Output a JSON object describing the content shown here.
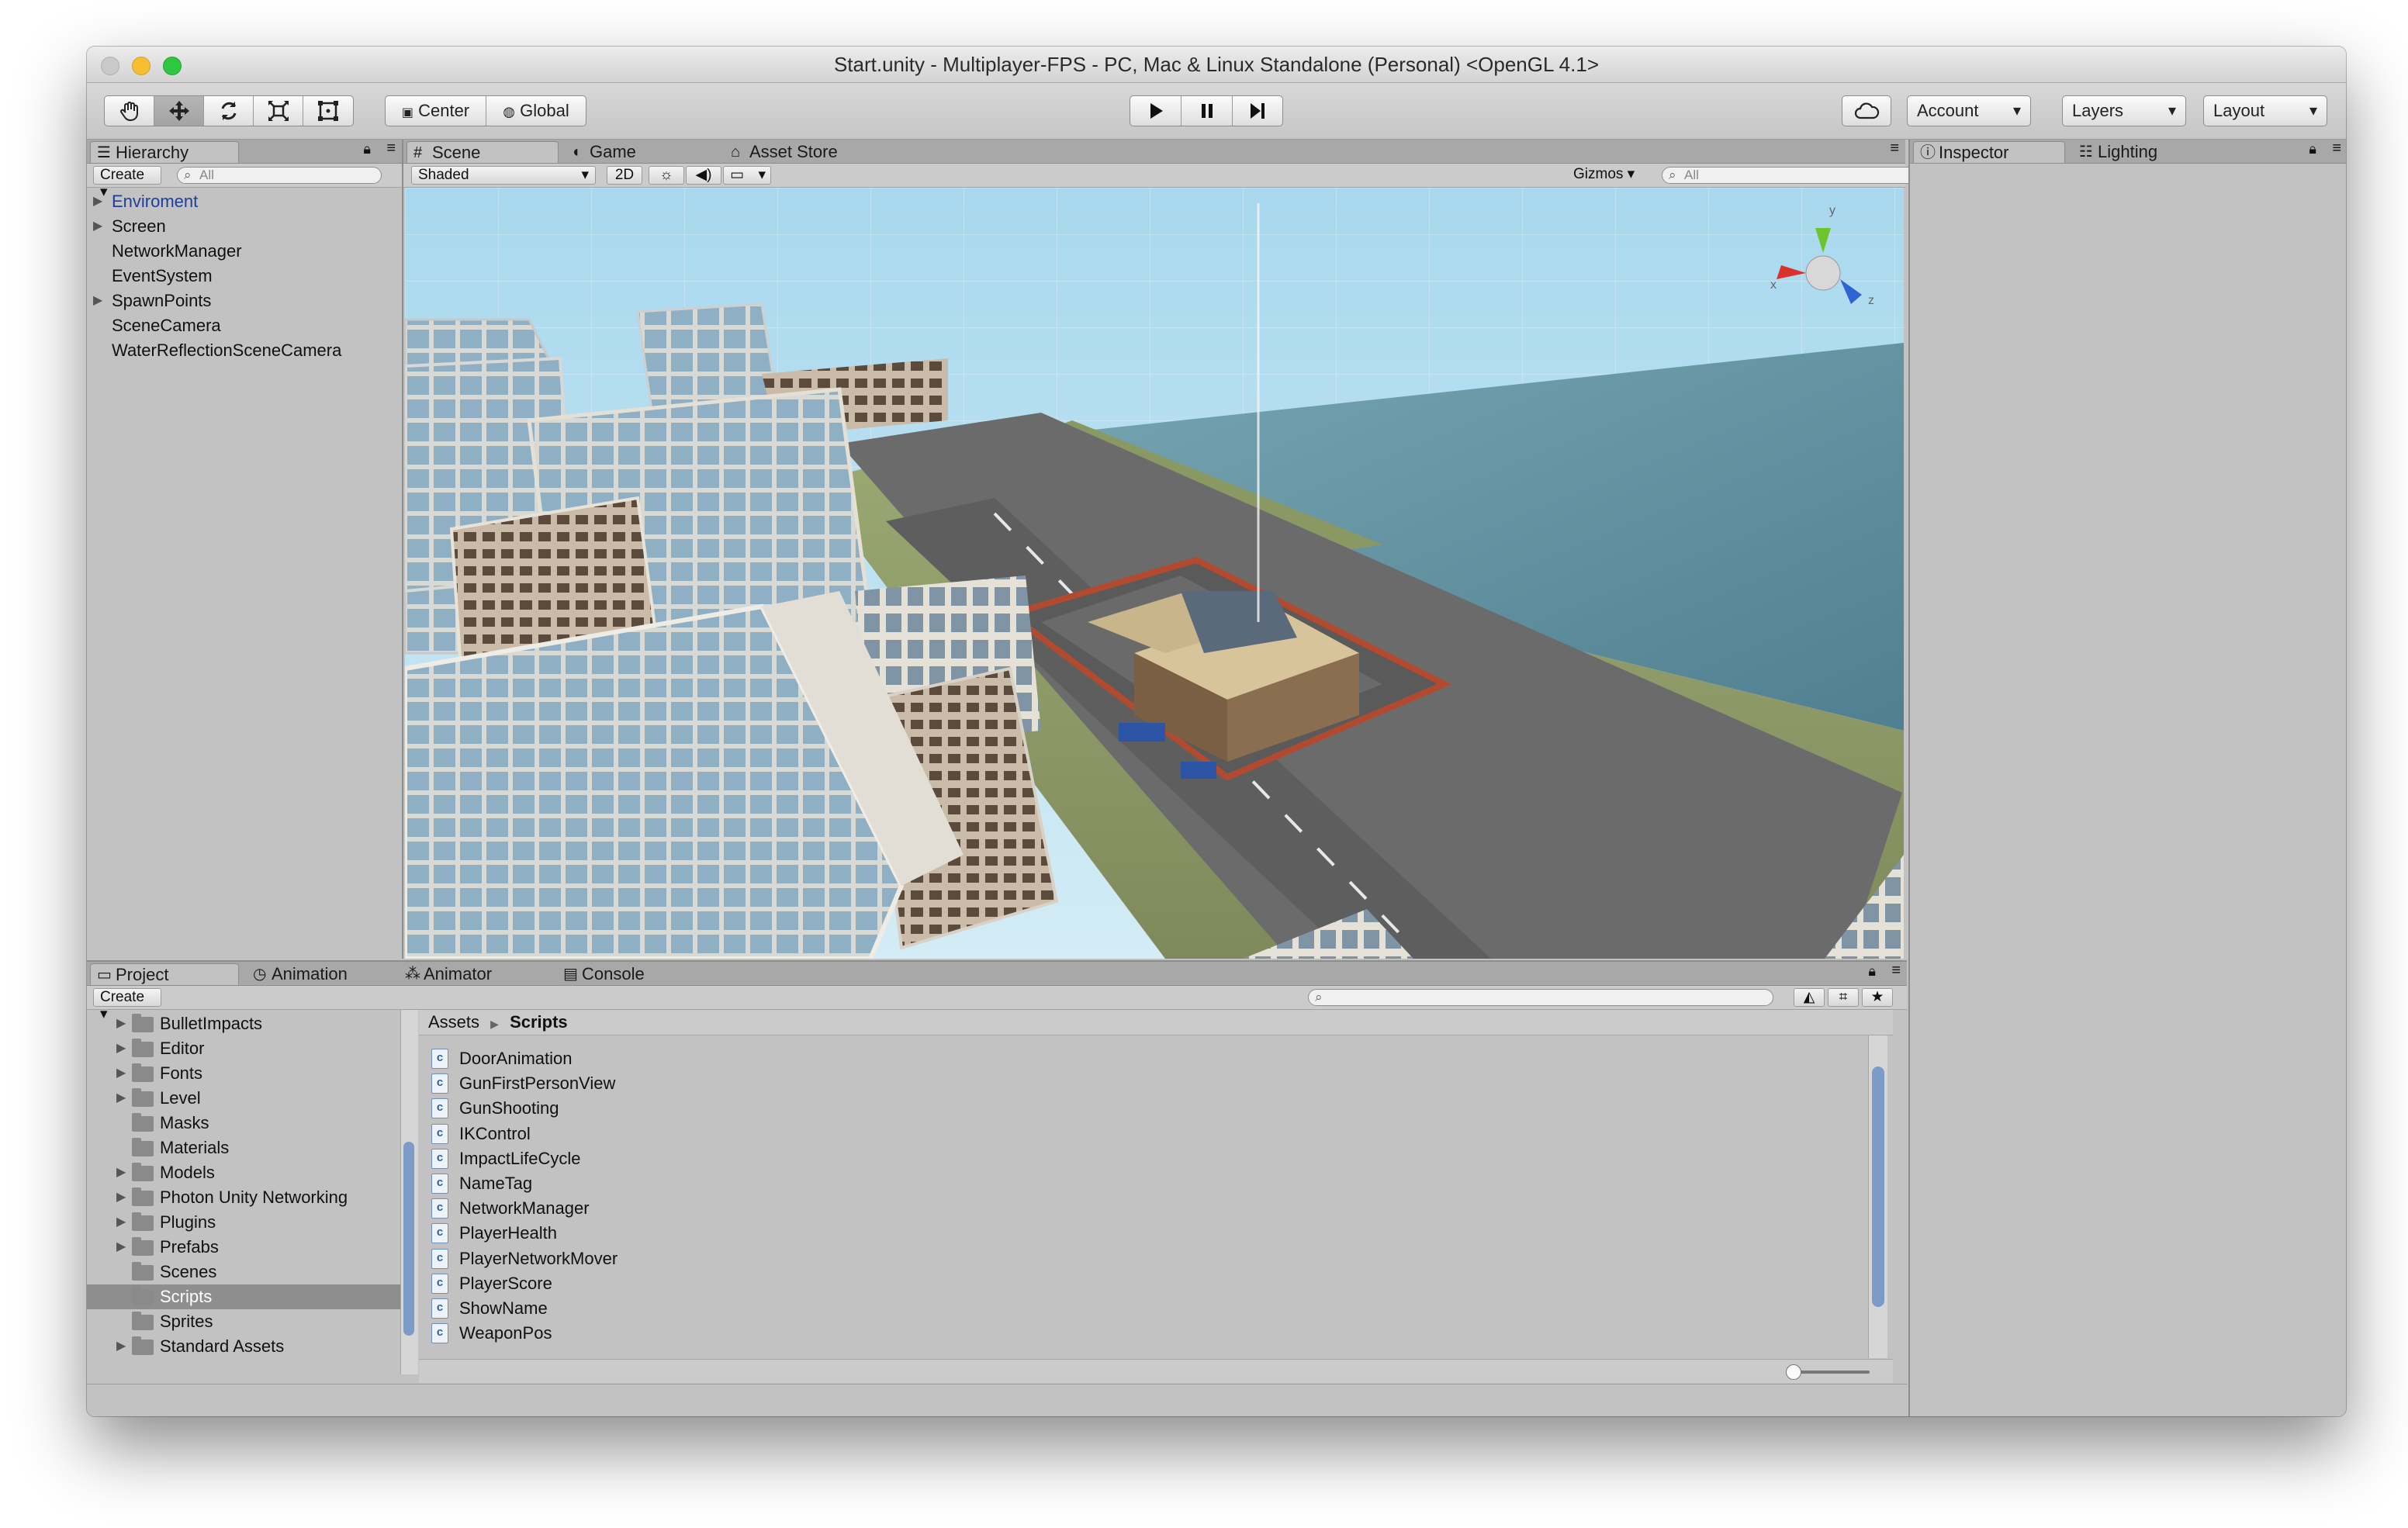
{
  "window": {
    "title": "Start.unity - Multiplayer-FPS - PC, Mac & Linux Standalone (Personal) <OpenGL 4.1>"
  },
  "toolbar": {
    "pivot_mode": "Center",
    "pivot_rotation": "Global",
    "account": "Account",
    "layers": "Layers",
    "layout": "Layout"
  },
  "hierarchy": {
    "tab": "Hierarchy",
    "create": "Create",
    "search_placeholder": "All",
    "items": [
      {
        "label": "Enviroment",
        "expandable": true,
        "selected": true
      },
      {
        "label": "Screen",
        "expandable": true
      },
      {
        "label": "NetworkManager",
        "expandable": false
      },
      {
        "label": "EventSystem",
        "expandable": false
      },
      {
        "label": "SpawnPoints",
        "expandable": true
      },
      {
        "label": "SceneCamera",
        "expandable": false
      },
      {
        "label": "WaterReflectionSceneCamera",
        "expandable": false
      }
    ]
  },
  "scene": {
    "tabs": [
      "Scene",
      "Game",
      "Asset Store"
    ],
    "shading": "Shaded",
    "mode_2d": "2D",
    "gizmos": "Gizmos",
    "search_placeholder": "All",
    "axis_x": "x",
    "axis_y": "y",
    "axis_z": "z"
  },
  "inspector": {
    "tabs": [
      "Inspector",
      "Lighting"
    ]
  },
  "project": {
    "tabs": [
      "Project",
      "Animation",
      "Animator",
      "Console"
    ],
    "create": "Create",
    "folders": [
      {
        "label": "BulletImpacts",
        "expandable": true
      },
      {
        "label": "Editor",
        "expandable": true
      },
      {
        "label": "Fonts",
        "expandable": true
      },
      {
        "label": "Level",
        "expandable": true
      },
      {
        "label": "Masks",
        "expandable": false
      },
      {
        "label": "Materials",
        "expandable": false
      },
      {
        "label": "Models",
        "expandable": true
      },
      {
        "label": "Photon Unity Networking",
        "expandable": true
      },
      {
        "label": "Plugins",
        "expandable": true
      },
      {
        "label": "Prefabs",
        "expandable": true
      },
      {
        "label": "Scenes",
        "expandable": false
      },
      {
        "label": "Scripts",
        "expandable": false,
        "selected": true
      },
      {
        "label": "Sprites",
        "expandable": false
      },
      {
        "label": "Standard Assets",
        "expandable": true
      }
    ],
    "breadcrumb": [
      "Assets",
      "Scripts"
    ],
    "scripts": [
      "DoorAnimation",
      "GunFirstPersonView",
      "GunShooting",
      "IKControl",
      "ImpactLifeCycle",
      "NameTag",
      "NetworkManager",
      "PlayerHealth",
      "PlayerNetworkMover",
      "PlayerScore",
      "ShowName",
      "WeaponPos"
    ]
  },
  "colors": {
    "editor_bg": "#c2c2c2",
    "selection": "#8e8e8e",
    "hierarchy_selected_text": "#1b3f9a",
    "sky": "#bfe4f4",
    "water": "#5d8fa0",
    "road": "#6b6b6b"
  }
}
